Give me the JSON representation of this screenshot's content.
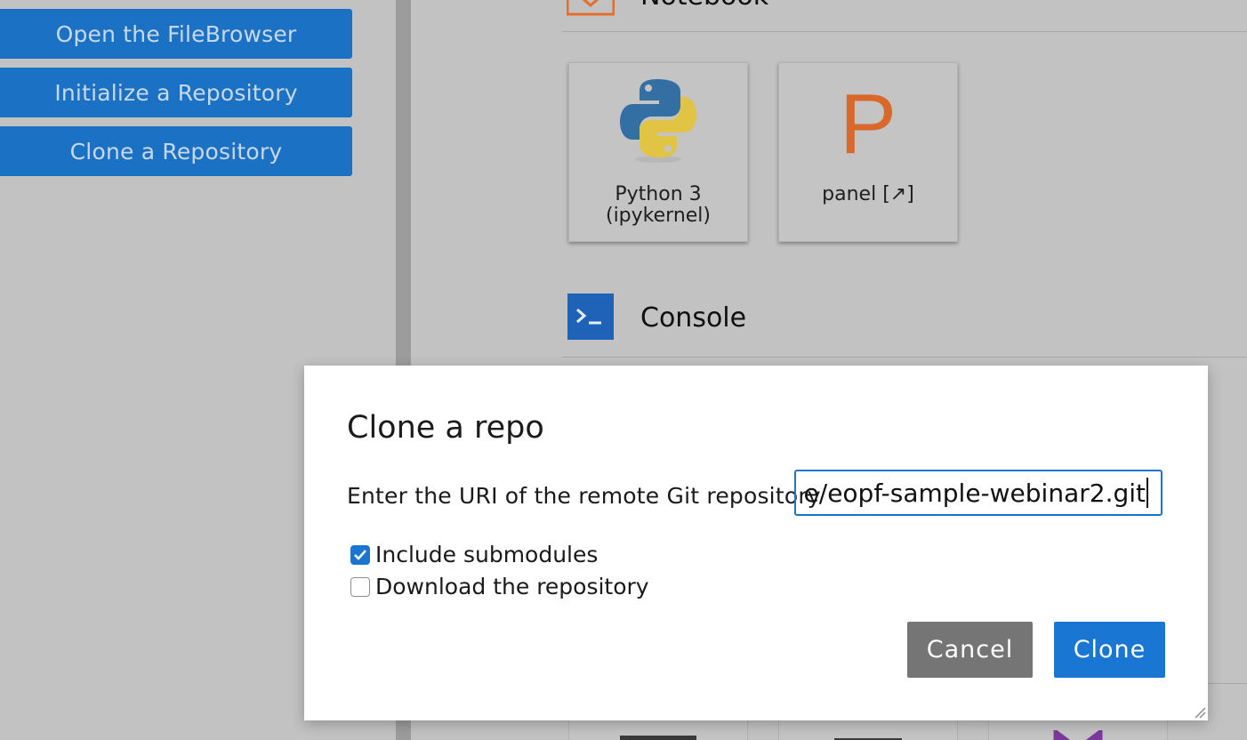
{
  "git_panel": {
    "open_filebrowser": "Open the FileBrowser",
    "initialize_repo": "Initialize a Repository",
    "clone_repo": "Clone a Repository"
  },
  "launcher": {
    "notebook_section": "Notebook",
    "console_section": "Console",
    "kernels": [
      {
        "label_line1": "Python 3",
        "label_line2": "(ipykernel)",
        "icon": "python-logo-icon"
      },
      {
        "label_line1": "panel [↗]",
        "label_line2": "",
        "icon": "panel-p-icon"
      }
    ],
    "panel_letter": "P",
    "colors": {
      "notebook_icon": "#e46e2e",
      "console_icon": "#1f63b8",
      "panel_p": "#d9682a"
    }
  },
  "dialog": {
    "title": "Clone a repo",
    "uri_label": "Enter the URI of the remote Git repository",
    "uri_value": "e/eopf-sample-webinar2.git",
    "include_submodules": {
      "label": "Include submodules",
      "checked": true
    },
    "download_repo": {
      "label": "Download the repository",
      "checked": false
    },
    "cancel_label": "Cancel",
    "clone_label": "Clone",
    "colors": {
      "primary": "#1976d2",
      "cancel": "#757575"
    }
  }
}
